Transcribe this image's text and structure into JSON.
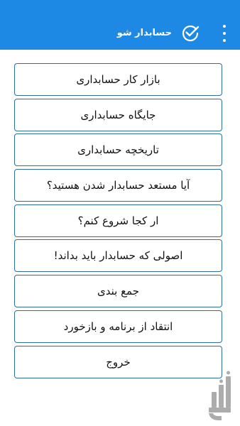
{
  "header": {
    "title": "حسابدار شو",
    "check_icon": "check-circle-icon",
    "menu_icon": "more-vert-icon",
    "color": "#1e88e5"
  },
  "menu": {
    "items": [
      {
        "label": "بازار کار حسابداری"
      },
      {
        "label": "جایگاه حسابداری"
      },
      {
        "label": "تاریخچه حسابداری"
      },
      {
        "label": "آیا مستعد حسابدار شدن هستید؟"
      },
      {
        "label": "ار کجا شروع کنم؟"
      },
      {
        "label": "اصولی که حسابدار باید بداند!"
      },
      {
        "label": "جمع بندی"
      },
      {
        "label": "انتقاد از برنامه و بازخورد"
      },
      {
        "label": "خروج"
      }
    ],
    "border_color": "#2d6da3"
  },
  "watermark": {
    "icon": "store-logo-watermark"
  }
}
